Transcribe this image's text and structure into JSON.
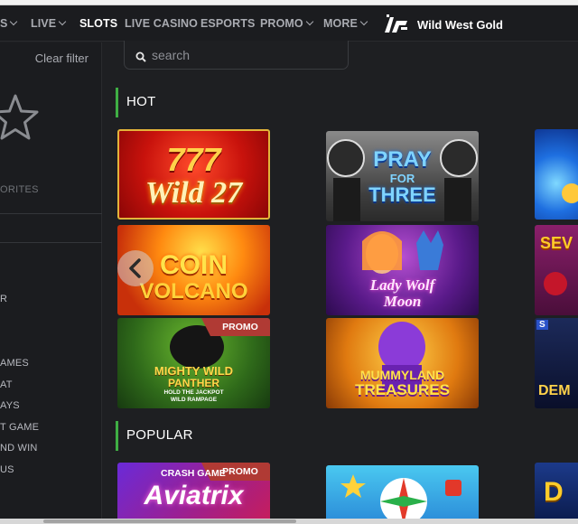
{
  "nav": {
    "partial_first_label": "S",
    "items": [
      {
        "label": "LIVE",
        "dropdown": true,
        "active": false
      },
      {
        "label": "SLOTS",
        "dropdown": false,
        "active": true
      },
      {
        "label": "LIVE CASINO",
        "dropdown": false,
        "active": false
      },
      {
        "label": "ESPORTS",
        "dropdown": false,
        "active": false
      },
      {
        "label": "PROMO",
        "dropdown": true,
        "active": false
      },
      {
        "label": "MORE",
        "dropdown": true,
        "active": false
      }
    ],
    "brand_name": "Wild West Gold",
    "brand_icon": "brand-logo-icon"
  },
  "sidebar": {
    "clear_filter": "Clear filter",
    "favorites_icon": "star-icon",
    "favorites_label": "ORITES",
    "items": [
      "R",
      "AMES",
      "AT",
      "AYS",
      "T GAME",
      "ND WIN",
      "US"
    ]
  },
  "search": {
    "placeholder": "search",
    "icon": "search-icon"
  },
  "sections": {
    "hot": {
      "title": "HOT"
    },
    "popular": {
      "title": "POPULAR"
    }
  },
  "games": {
    "wild27": {
      "line1": "777",
      "line2": "Wild 27"
    },
    "prayforthree": {
      "line1": "PRAY",
      "line2": "FOR",
      "line3": "THREE"
    },
    "coinvolcano": {
      "line1": "COIN",
      "line2": "VOLCANO"
    },
    "ladywolfmoon": {
      "line1": "Lady Wolf",
      "line2": "Moon"
    },
    "mightywild": {
      "line1": "MIGHTY WILD",
      "line2": "PANTHER",
      "line3": "HOLD THE JACKPOT",
      "line4": "WILD RAMPAGE",
      "badge": "PROMO"
    },
    "mummyland": {
      "line1": "MUMMYLAND",
      "line2": "TREASURES"
    },
    "aviatrix": {
      "line1": "CRASH GAME",
      "line2": "Aviatrix",
      "badge": "PROMO"
    },
    "partial_sev": {
      "line1": "SEV"
    },
    "partial_dem": {
      "line1": "DEM",
      "corner": "S"
    },
    "partial_d": {
      "line1": "D"
    }
  },
  "colors": {
    "accent_green": "#3fae44",
    "promo_red": "#b03a34",
    "bg": "#1e1f22"
  }
}
